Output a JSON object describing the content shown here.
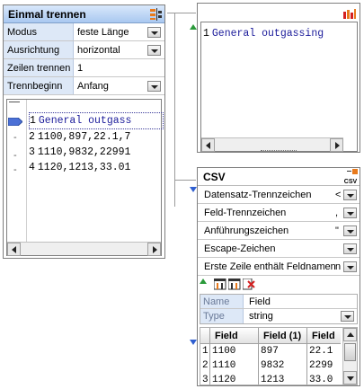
{
  "split_panel": {
    "title": "Einmal trennen",
    "rows": [
      {
        "label": "Modus",
        "value": "feste Länge",
        "dropdown": true
      },
      {
        "label": "Ausrichtung",
        "value": "horizontal",
        "dropdown": true
      },
      {
        "label": "Zeilen trennen",
        "value": "1",
        "dropdown": false
      },
      {
        "label": "Trennbeginn",
        "value": "Anfang",
        "dropdown": true
      }
    ],
    "lines": [
      {
        "num": "1",
        "text": "General outgass"
      },
      {
        "num": "2",
        "text": "1100,897,22.1,7"
      },
      {
        "num": "3",
        "text": "1110,9832,22991"
      },
      {
        "num": "4",
        "text": "1120,1213,33.01"
      }
    ],
    "gutter_marks": [
      "-",
      "-",
      "-"
    ]
  },
  "preview_panel": {
    "lines": [
      {
        "num": "1",
        "text": "General outgassing"
      }
    ]
  },
  "csv_panel": {
    "title": "CSV",
    "icon_label": "CSV",
    "rows": [
      {
        "label": "Datensatz-Trennzeichen",
        "value": "<"
      },
      {
        "label": "Feld-Trennzeichen",
        "value": ","
      },
      {
        "label": "Anführungszeichen",
        "value": "\""
      },
      {
        "label": "Escape-Zeichen",
        "value": ""
      },
      {
        "label": "Erste Zeile enthält Feldnamen",
        "value": "n"
      }
    ],
    "field_props": [
      {
        "label": "Name",
        "value": "Field",
        "dropdown": false
      },
      {
        "label": "Type",
        "value": "string",
        "dropdown": true
      }
    ],
    "grid": {
      "headers": [
        "Field",
        "Field (1)",
        "Field"
      ],
      "rows": [
        {
          "num": "1",
          "cells": [
            "1100",
            "897",
            "22.1"
          ]
        },
        {
          "num": "2",
          "cells": [
            "1110",
            "9832",
            "2299"
          ]
        },
        {
          "num": "3",
          "cells": [
            "1120",
            "1213",
            "33.0"
          ]
        }
      ]
    }
  },
  "colors": {
    "header_blue": "#a9c8f0",
    "label_blue": "#dde8f7",
    "accent_orange": "#e87a1c",
    "delete_red": "#d42020",
    "connector_green": "#2a9a3a",
    "connector_blue": "#2f5fd0"
  }
}
